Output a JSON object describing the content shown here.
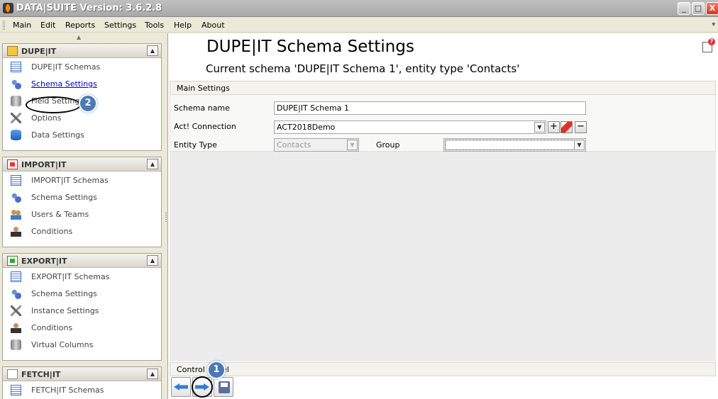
{
  "window": {
    "title": "DATA|SUITE Version: 3.6.2.8",
    "minimize_label": "_",
    "maximize_label": "□",
    "close_label": "X"
  },
  "menu": {
    "items": [
      "Main",
      "Edit",
      "Reports",
      "Settings",
      "Tools",
      "Help",
      "About"
    ]
  },
  "sidebar": {
    "panels": [
      {
        "title": "DUPE|IT",
        "collapse_glyph": "^",
        "items": [
          {
            "label": "DUPE|IT Schemas",
            "icon": "list-icon"
          },
          {
            "label": "Schema Settings",
            "icon": "gears-icon",
            "active": true
          },
          {
            "label": "Field Settings",
            "icon": "cylinder-icon"
          },
          {
            "label": "Options",
            "icon": "tools-icon"
          },
          {
            "label": "Data Settings",
            "icon": "database-icon"
          }
        ]
      },
      {
        "title": "IMPORT|IT",
        "collapse_glyph": "^",
        "items": [
          {
            "label": "IMPORT|IT Schemas",
            "icon": "list-icon"
          },
          {
            "label": "Schema Settings",
            "icon": "gears-icon"
          },
          {
            "label": "Users & Teams",
            "icon": "users-icon"
          },
          {
            "label": "Conditions",
            "icon": "person-icon"
          }
        ]
      },
      {
        "title": "EXPORT|IT",
        "collapse_glyph": "^",
        "items": [
          {
            "label": "EXPORT|IT Schemas",
            "icon": "list-icon"
          },
          {
            "label": "Schema Settings",
            "icon": "gears-icon"
          },
          {
            "label": "Instance Settings",
            "icon": "tools-icon"
          },
          {
            "label": "Conditions",
            "icon": "person-icon"
          },
          {
            "label": "Virtual Columns",
            "icon": "cylinder-icon"
          }
        ]
      },
      {
        "title": "FETCH|IT",
        "collapse_glyph": "^",
        "items": [
          {
            "label": "FETCH|IT Schemas",
            "icon": "list-icon"
          }
        ]
      }
    ]
  },
  "main": {
    "title": "DUPE|IT Schema Settings",
    "subtitle": "Current schema 'DUPE|IT Schema 1', entity type 'Contacts'",
    "section_title": "Main Settings",
    "fields": {
      "schema_name_label": "Schema name",
      "schema_name_value": "DUPE|IT Schema 1",
      "connection_label": "Act! Connection",
      "connection_value": "ACT2018Demo",
      "entity_type_label": "Entity Type",
      "entity_type_value": "Contacts",
      "group_label": "Group",
      "group_value": ""
    },
    "control_panel_title": "Control panel"
  },
  "annotations": {
    "badge_1": "1",
    "badge_2": "2"
  }
}
